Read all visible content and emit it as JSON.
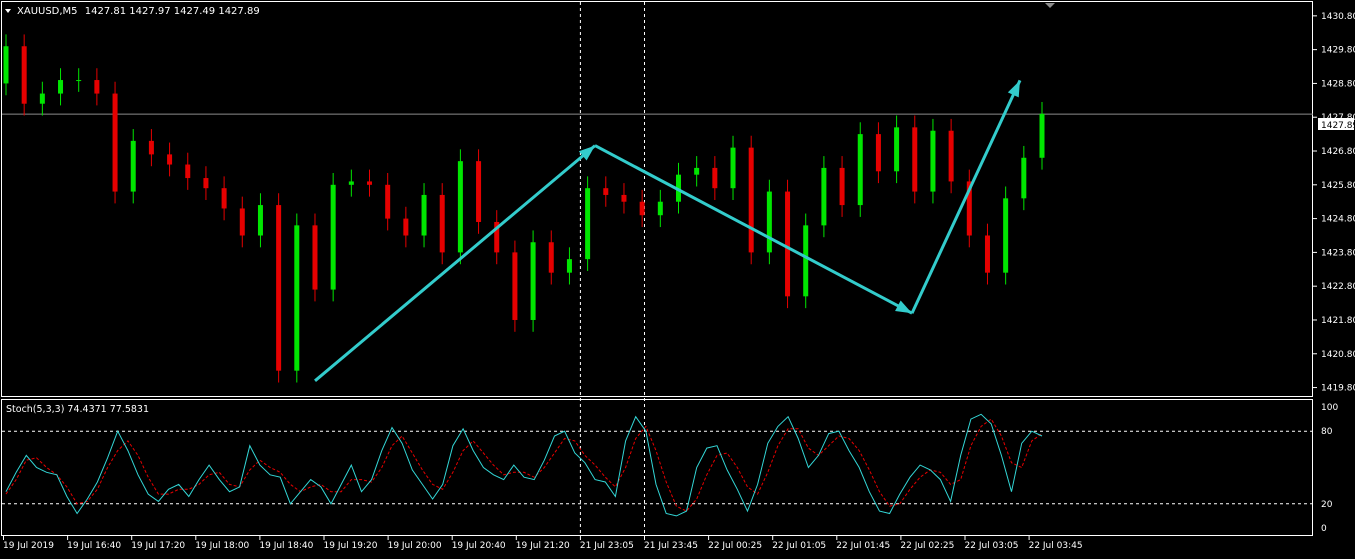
{
  "header": {
    "symbol_timeframe": "XAUUSD,M5",
    "ohlc": "1427.81 1427.97 1427.49 1427.89"
  },
  "indicator": {
    "label": "Stoch(5,3,3) 74.4371 77.5831",
    "levels": [
      100,
      80,
      20,
      0
    ]
  },
  "current_price_label": "1427.89",
  "colors": {
    "background": "#000000",
    "border": "#ffffff",
    "bull": "#00e600",
    "bear": "#e60000",
    "main_line": "#33d6d6",
    "signal_line": "#e60000",
    "arrows": "#33cccc"
  },
  "chart_data": [
    {
      "type": "candlestick",
      "symbol": "XAUUSD",
      "timeframe": "M5",
      "y_ticks": [
        1430.8,
        1429.8,
        1428.8,
        1427.8,
        1426.8,
        1425.8,
        1424.8,
        1423.8,
        1422.8,
        1421.8,
        1420.8,
        1419.8
      ],
      "x_ticks": [
        "19 Jul 2019",
        "19 Jul 16:40",
        "19 Jul 17:20",
        "19 Jul 18:00",
        "19 Jul 18:40",
        "19 Jul 19:20",
        "19 Jul 20:00",
        "19 Jul 20:40",
        "19 Jul 21:20",
        "21 Jul 23:05",
        "21 Jul 23:45",
        "22 Jul 00:25",
        "22 Jul 01:05",
        "22 Jul 01:45",
        "22 Jul 02:25",
        "22 Jul 03:05",
        "22 Jul 03:45"
      ],
      "ylim": [
        1419.58,
        1431.18
      ],
      "bull_closes": [
        1429.9,
        1428.5,
        1428.9,
        1425.6,
        1426.7,
        1426.0,
        1425.1,
        1425.2,
        1424.6,
        1425.8,
        1425.8,
        1424.3,
        1423.8,
        1424.7,
        1421.8,
        1423.2,
        1425.7,
        1425.3,
        1425.3,
        1426.3,
        1426.9,
        1425.6,
        1424.6,
        1425.2,
        1426.2,
        1425.6,
        1425.9,
        1424.3,
        1423.2,
        1425.4,
        1426.6,
        1427.9
      ],
      "bear_closes": [
        1428.2,
        1428.9,
        1428.5,
        1427.1,
        1426.4,
        1425.7,
        1424.3,
        1420.3,
        1422.7,
        1425.9,
        1424.8,
        1425.5,
        1426.5,
        1423.8,
        1424.1,
        1423.6,
        1425.5,
        1424.9,
        1426.1,
        1425.7,
        1423.8,
        1422.5,
        1426.3,
        1427.3,
        1427.5,
        1427.4
      ],
      "last_close": 1427.89,
      "trend_arrows_price_path": [
        1420.0,
        1426.96,
        1422.0,
        1428.89
      ],
      "vertical_marker_times": [
        "21 Jul 23:05",
        "21 Jul 23:45"
      ]
    },
    {
      "type": "line",
      "name": "Stoch(5,3,3)",
      "ylim": [
        0,
        100
      ],
      "levels": [
        80,
        20
      ],
      "last_main": 74.4371,
      "last_signal": 77.5831,
      "main_values": [
        30,
        46,
        60,
        50,
        46,
        44,
        26,
        12,
        24,
        38,
        58,
        80,
        64,
        44,
        28,
        22,
        32,
        36,
        26,
        40,
        52,
        40,
        30,
        34,
        68,
        52,
        44,
        42,
        20,
        30,
        40,
        34,
        20,
        36,
        52,
        30,
        40,
        64,
        83,
        70,
        48,
        36,
        24,
        36,
        68,
        82,
        64,
        50,
        44,
        40,
        52,
        42,
        40,
        56,
        76,
        80,
        62,
        54,
        40,
        38,
        26,
        72,
        92,
        80,
        36,
        12,
        10,
        14,
        50,
        66,
        68,
        48,
        32,
        14,
        36,
        70,
        84,
        92,
        74,
        50,
        60,
        78,
        80,
        64,
        50,
        30,
        14,
        12,
        28,
        42,
        52,
        48,
        40,
        22,
        60,
        90,
        94,
        86,
        60,
        30,
        70,
        80,
        76
      ],
      "signal_values": [
        28,
        40,
        56,
        58,
        50,
        44,
        34,
        20,
        22,
        32,
        50,
        64,
        72,
        60,
        42,
        28,
        28,
        32,
        32,
        36,
        44,
        46,
        36,
        34,
        48,
        56,
        50,
        46,
        36,
        30,
        34,
        36,
        30,
        30,
        40,
        40,
        38,
        50,
        68,
        76,
        62,
        48,
        36,
        32,
        46,
        64,
        72,
        62,
        52,
        44,
        46,
        46,
        42,
        50,
        62,
        74,
        72,
        60,
        52,
        42,
        34,
        50,
        74,
        84,
        64,
        38,
        18,
        14,
        24,
        44,
        60,
        62,
        50,
        34,
        28,
        46,
        68,
        82,
        82,
        66,
        60,
        68,
        76,
        74,
        64,
        48,
        30,
        18,
        20,
        32,
        42,
        48,
        46,
        36,
        40,
        68,
        84,
        90,
        76,
        54,
        50,
        72,
        78
      ]
    }
  ]
}
